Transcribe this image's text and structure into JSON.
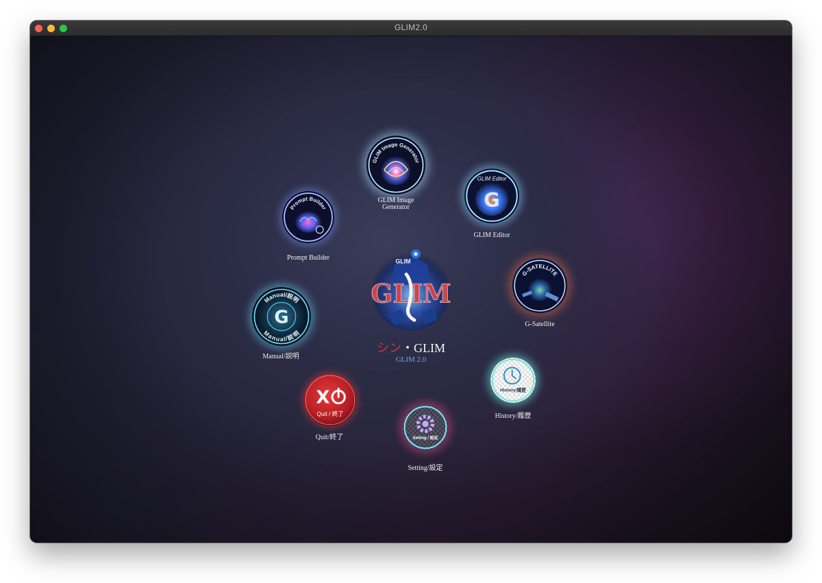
{
  "window": {
    "title": "GLIM2.0"
  },
  "center": {
    "logo_text": "GLIM",
    "title_jp": "シン",
    "title_sep": "・",
    "title_en": "GLIM",
    "subtitle": "GLIM 2.0"
  },
  "apps": {
    "image_generator": {
      "label": "GLIM Image Generator",
      "badge": "GLIM Image Generator"
    },
    "editor": {
      "label": "GLIM Editor",
      "badge": "GLIM Editor"
    },
    "prompt_builder": {
      "label": "Prompt Builder",
      "badge": "Prompt Builder"
    },
    "satellite": {
      "label": "G-Satellite",
      "badge": "G-SATELLITE"
    },
    "manual": {
      "label": "Manual/説明",
      "badge": "Manual/説明"
    },
    "history": {
      "label": "History/履歴",
      "badge": "History/履歴"
    },
    "quit": {
      "label": "Quit/終了",
      "badge": "Quit / 終了"
    },
    "setting": {
      "label": "Setting/設定",
      "badge": "Setting / 設定"
    }
  },
  "colors": {
    "accent_red": "#d8323a",
    "accent_blue": "#6aa8e0"
  }
}
